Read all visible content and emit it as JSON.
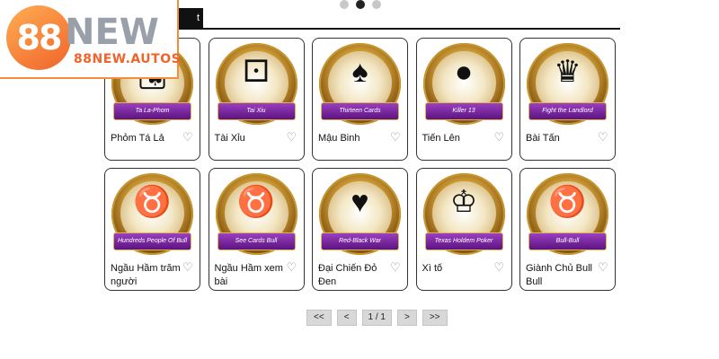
{
  "logo": {
    "mark": "88",
    "brand": "NEW",
    "domain": "88NEW.AUTOS"
  },
  "tab": {
    "active_label": "t"
  },
  "carousel": {
    "dots": 3,
    "active": 1
  },
  "games": [
    {
      "name": "Phỏm Tá Lả",
      "ribbon": "Ta La-Phom",
      "icon": "phom-cards-icon"
    },
    {
      "name": "Tài Xỉu",
      "ribbon": "Tai Xiu",
      "icon": "dice-cup-icon"
    },
    {
      "name": "Mậu Binh",
      "ribbon": "Thirteen Cards",
      "icon": "revolver-cards-icon"
    },
    {
      "name": "Tiến Lên",
      "ribbon": "Killer 13",
      "icon": "bomb-cards-icon"
    },
    {
      "name": "Bài Tấn",
      "ribbon": "Fight the Landlord",
      "icon": "landlord-icon"
    },
    {
      "name": "Ngầu Hầm trăm người",
      "ribbon": "Hundreds People Of Bull",
      "icon": "bull-horns-icon"
    },
    {
      "name": "Ngầu Hầm xem bài",
      "ribbon": "See Cards Bull",
      "icon": "bull-mascot-icon"
    },
    {
      "name": "Đại Chiến Đỏ Đen",
      "ribbon": "Red-Black War",
      "icon": "vs-cards-icon"
    },
    {
      "name": "Xì tố",
      "ribbon": "Texas Holdem Poker",
      "icon": "crown-cards-icon"
    },
    {
      "name": "Giành Chủ Bull Bull",
      "ribbon": "Bull-Bull",
      "icon": "gold-bull-icon"
    }
  ],
  "pagination": {
    "first": "<<",
    "prev": "<",
    "page": "1 / 1",
    "next": ">",
    "last": ">>"
  },
  "colors": {
    "accent": "#f0632a",
    "ribbon": "#7a2aa8",
    "gold": "#d9a73a"
  }
}
